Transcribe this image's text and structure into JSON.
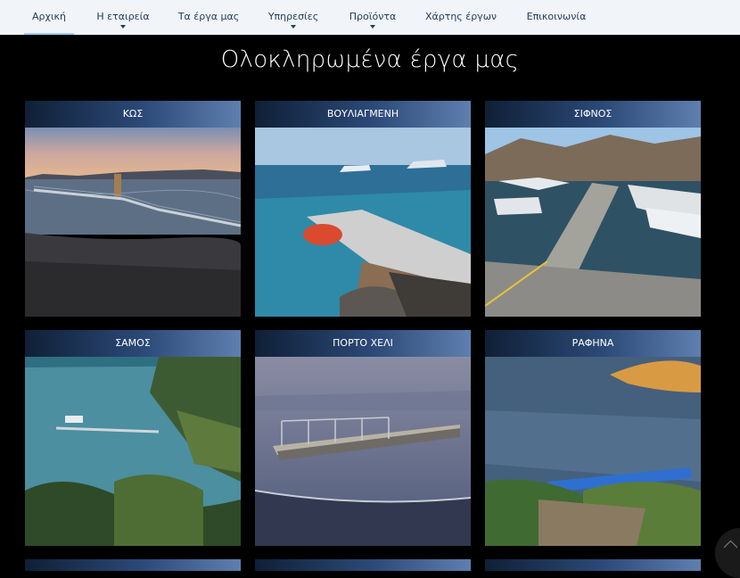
{
  "nav": {
    "items": [
      {
        "label": "Αρχική",
        "active": true,
        "dropdown": false
      },
      {
        "label": "Η εταιρεία",
        "active": false,
        "dropdown": true
      },
      {
        "label": "Τα έργα μας",
        "active": false,
        "dropdown": false
      },
      {
        "label": "Υπηρεσίες",
        "active": false,
        "dropdown": true
      },
      {
        "label": "Προϊόντα",
        "active": false,
        "dropdown": true
      },
      {
        "label": "Χάρτης έργων",
        "active": false,
        "dropdown": false
      },
      {
        "label": "Επικοινωνία",
        "active": false,
        "dropdown": false
      }
    ]
  },
  "main": {
    "title": "Ολοκληρωμένα έργα μας",
    "projects": [
      {
        "name": "ΚΩΣ"
      },
      {
        "name": "ΒΟΥΛΙΑΓΜΕΝΗ"
      },
      {
        "name": "ΣΙΦΝΟΣ"
      },
      {
        "name": "ΣΑΜΟΣ"
      },
      {
        "name": "ΠΟΡΤΟ ΧΕΛΙ"
      },
      {
        "name": "ΡΑΦΗΝΑ"
      }
    ]
  },
  "colors": {
    "nav_bg": "#f1f4f8",
    "nav_text": "#1e3a5f",
    "active_underline": "#9ecdf0",
    "page_bg": "#000000",
    "header_gradient_start": "#0f1f36",
    "header_gradient_end": "#5e7faf"
  },
  "icons": {
    "dropdown": "chevron-down-icon",
    "scroll_top": "arrow-up-icon"
  }
}
